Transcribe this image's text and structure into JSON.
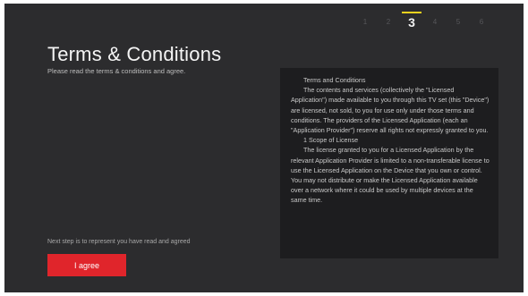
{
  "steps": {
    "items": [
      "1",
      "2",
      "3",
      "4",
      "5",
      "6"
    ],
    "active": "3"
  },
  "page": {
    "title": "Terms & Conditions",
    "subtitle": "Please read the terms & conditions and agree."
  },
  "terms": {
    "heading": "Terms and Conditions",
    "paragraph1": "The contents and services (collectively the \"Licensed Application\") made available to you through this TV set (this \"Device\") are licensed, not sold, to you for use only under those terms and conditions. The providers of the Licensed Application (each an \"Application Provider\") reserve all rights not expressly granted to you.",
    "section1": "1 Scope of License",
    "paragraph2": "The license granted to you for a Licensed Application by the relevant Application Provider is limited to a non-transferable license to use the Licensed Application on the Device that you own or control. You may not distribute or make the Licensed Application available over a network where it could be used by multiple devices at the same time."
  },
  "footer": {
    "note": "Next step is to represent you have read and agreed",
    "agree_label": "I agree"
  },
  "colors": {
    "background": "#2c2c2e",
    "terms_box": "#1d1d1f",
    "accent": "#e0252b",
    "step_indicator": "#f2d21e"
  }
}
